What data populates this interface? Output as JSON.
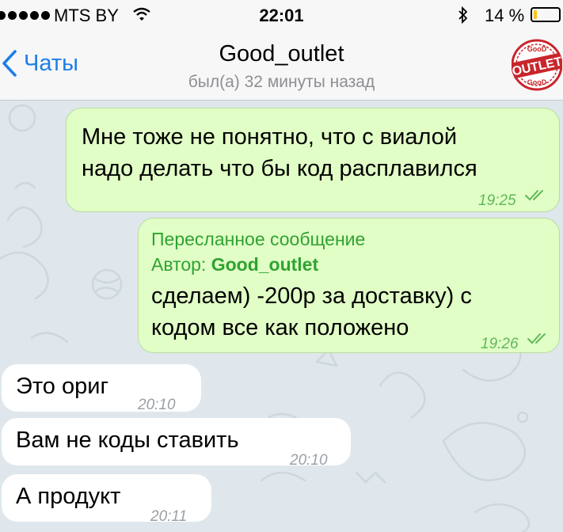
{
  "status_bar": {
    "carrier": "MTS BY",
    "time": "22:01",
    "battery_percent": "14 %",
    "battery_level": 0.14,
    "icons": [
      "signal-dots-icon",
      "wifi-icon",
      "bluetooth-icon",
      "battery-icon"
    ]
  },
  "nav": {
    "back_label": "Чаты",
    "title": "Good_outlet",
    "subtitle": "был(а) 32 минуты назад",
    "avatar_text": "OUTLET",
    "avatar_small_text": "GooD"
  },
  "messages": [
    {
      "direction": "outgoing",
      "lines": [
        "Мне тоже не понятно, что с виалой",
        "надо делать что бы код расплавился"
      ],
      "time": "19:25",
      "read": true
    },
    {
      "direction": "outgoing",
      "forwarded_header": "Пересланное сообщение",
      "forwarded_author_label": "Автор:",
      "forwarded_author": "Good_outlet",
      "lines": [
        "сделаем) -200р за доставку) с",
        "кодом все как положено"
      ],
      "time": "19:26",
      "read": true
    },
    {
      "direction": "incoming",
      "text": "Это ориг",
      "time": "20:10"
    },
    {
      "direction": "incoming",
      "text": "Вам не коды ставить",
      "time": "20:10"
    },
    {
      "direction": "incoming",
      "text": "А продукт",
      "time": "20:11"
    }
  ],
  "colors": {
    "accent": "#1e7ee8",
    "outgoing_bubble": "#e1fec6",
    "incoming_bubble": "#ffffff",
    "chat_background": "#dfe7ec",
    "check_color": "#5fb85a",
    "forward_green": "#2fa332",
    "battery_yellow": "#f5c518"
  }
}
